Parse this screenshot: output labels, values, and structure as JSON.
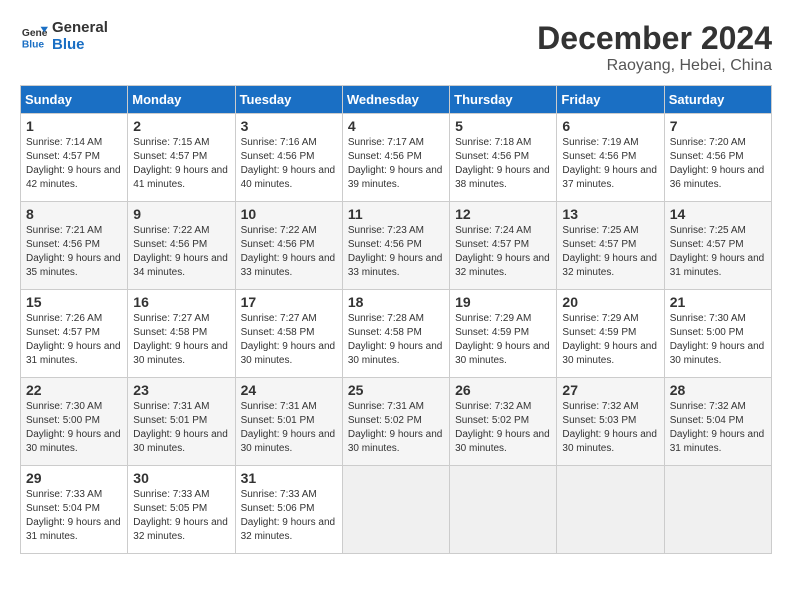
{
  "header": {
    "logo_line1": "General",
    "logo_line2": "Blue",
    "month": "December 2024",
    "location": "Raoyang, Hebei, China"
  },
  "weekdays": [
    "Sunday",
    "Monday",
    "Tuesday",
    "Wednesday",
    "Thursday",
    "Friday",
    "Saturday"
  ],
  "weeks": [
    [
      {
        "day": "1",
        "sunrise": "Sunrise: 7:14 AM",
        "sunset": "Sunset: 4:57 PM",
        "daylight": "Daylight: 9 hours and 42 minutes."
      },
      {
        "day": "2",
        "sunrise": "Sunrise: 7:15 AM",
        "sunset": "Sunset: 4:57 PM",
        "daylight": "Daylight: 9 hours and 41 minutes."
      },
      {
        "day": "3",
        "sunrise": "Sunrise: 7:16 AM",
        "sunset": "Sunset: 4:56 PM",
        "daylight": "Daylight: 9 hours and 40 minutes."
      },
      {
        "day": "4",
        "sunrise": "Sunrise: 7:17 AM",
        "sunset": "Sunset: 4:56 PM",
        "daylight": "Daylight: 9 hours and 39 minutes."
      },
      {
        "day": "5",
        "sunrise": "Sunrise: 7:18 AM",
        "sunset": "Sunset: 4:56 PM",
        "daylight": "Daylight: 9 hours and 38 minutes."
      },
      {
        "day": "6",
        "sunrise": "Sunrise: 7:19 AM",
        "sunset": "Sunset: 4:56 PM",
        "daylight": "Daylight: 9 hours and 37 minutes."
      },
      {
        "day": "7",
        "sunrise": "Sunrise: 7:20 AM",
        "sunset": "Sunset: 4:56 PM",
        "daylight": "Daylight: 9 hours and 36 minutes."
      }
    ],
    [
      {
        "day": "8",
        "sunrise": "Sunrise: 7:21 AM",
        "sunset": "Sunset: 4:56 PM",
        "daylight": "Daylight: 9 hours and 35 minutes."
      },
      {
        "day": "9",
        "sunrise": "Sunrise: 7:22 AM",
        "sunset": "Sunset: 4:56 PM",
        "daylight": "Daylight: 9 hours and 34 minutes."
      },
      {
        "day": "10",
        "sunrise": "Sunrise: 7:22 AM",
        "sunset": "Sunset: 4:56 PM",
        "daylight": "Daylight: 9 hours and 33 minutes."
      },
      {
        "day": "11",
        "sunrise": "Sunrise: 7:23 AM",
        "sunset": "Sunset: 4:56 PM",
        "daylight": "Daylight: 9 hours and 33 minutes."
      },
      {
        "day": "12",
        "sunrise": "Sunrise: 7:24 AM",
        "sunset": "Sunset: 4:57 PM",
        "daylight": "Daylight: 9 hours and 32 minutes."
      },
      {
        "day": "13",
        "sunrise": "Sunrise: 7:25 AM",
        "sunset": "Sunset: 4:57 PM",
        "daylight": "Daylight: 9 hours and 32 minutes."
      },
      {
        "day": "14",
        "sunrise": "Sunrise: 7:25 AM",
        "sunset": "Sunset: 4:57 PM",
        "daylight": "Daylight: 9 hours and 31 minutes."
      }
    ],
    [
      {
        "day": "15",
        "sunrise": "Sunrise: 7:26 AM",
        "sunset": "Sunset: 4:57 PM",
        "daylight": "Daylight: 9 hours and 31 minutes."
      },
      {
        "day": "16",
        "sunrise": "Sunrise: 7:27 AM",
        "sunset": "Sunset: 4:58 PM",
        "daylight": "Daylight: 9 hours and 30 minutes."
      },
      {
        "day": "17",
        "sunrise": "Sunrise: 7:27 AM",
        "sunset": "Sunset: 4:58 PM",
        "daylight": "Daylight: 9 hours and 30 minutes."
      },
      {
        "day": "18",
        "sunrise": "Sunrise: 7:28 AM",
        "sunset": "Sunset: 4:58 PM",
        "daylight": "Daylight: 9 hours and 30 minutes."
      },
      {
        "day": "19",
        "sunrise": "Sunrise: 7:29 AM",
        "sunset": "Sunset: 4:59 PM",
        "daylight": "Daylight: 9 hours and 30 minutes."
      },
      {
        "day": "20",
        "sunrise": "Sunrise: 7:29 AM",
        "sunset": "Sunset: 4:59 PM",
        "daylight": "Daylight: 9 hours and 30 minutes."
      },
      {
        "day": "21",
        "sunrise": "Sunrise: 7:30 AM",
        "sunset": "Sunset: 5:00 PM",
        "daylight": "Daylight: 9 hours and 30 minutes."
      }
    ],
    [
      {
        "day": "22",
        "sunrise": "Sunrise: 7:30 AM",
        "sunset": "Sunset: 5:00 PM",
        "daylight": "Daylight: 9 hours and 30 minutes."
      },
      {
        "day": "23",
        "sunrise": "Sunrise: 7:31 AM",
        "sunset": "Sunset: 5:01 PM",
        "daylight": "Daylight: 9 hours and 30 minutes."
      },
      {
        "day": "24",
        "sunrise": "Sunrise: 7:31 AM",
        "sunset": "Sunset: 5:01 PM",
        "daylight": "Daylight: 9 hours and 30 minutes."
      },
      {
        "day": "25",
        "sunrise": "Sunrise: 7:31 AM",
        "sunset": "Sunset: 5:02 PM",
        "daylight": "Daylight: 9 hours and 30 minutes."
      },
      {
        "day": "26",
        "sunrise": "Sunrise: 7:32 AM",
        "sunset": "Sunset: 5:02 PM",
        "daylight": "Daylight: 9 hours and 30 minutes."
      },
      {
        "day": "27",
        "sunrise": "Sunrise: 7:32 AM",
        "sunset": "Sunset: 5:03 PM",
        "daylight": "Daylight: 9 hours and 30 minutes."
      },
      {
        "day": "28",
        "sunrise": "Sunrise: 7:32 AM",
        "sunset": "Sunset: 5:04 PM",
        "daylight": "Daylight: 9 hours and 31 minutes."
      }
    ],
    [
      {
        "day": "29",
        "sunrise": "Sunrise: 7:33 AM",
        "sunset": "Sunset: 5:04 PM",
        "daylight": "Daylight: 9 hours and 31 minutes."
      },
      {
        "day": "30",
        "sunrise": "Sunrise: 7:33 AM",
        "sunset": "Sunset: 5:05 PM",
        "daylight": "Daylight: 9 hours and 32 minutes."
      },
      {
        "day": "31",
        "sunrise": "Sunrise: 7:33 AM",
        "sunset": "Sunset: 5:06 PM",
        "daylight": "Daylight: 9 hours and 32 minutes."
      },
      null,
      null,
      null,
      null
    ]
  ]
}
